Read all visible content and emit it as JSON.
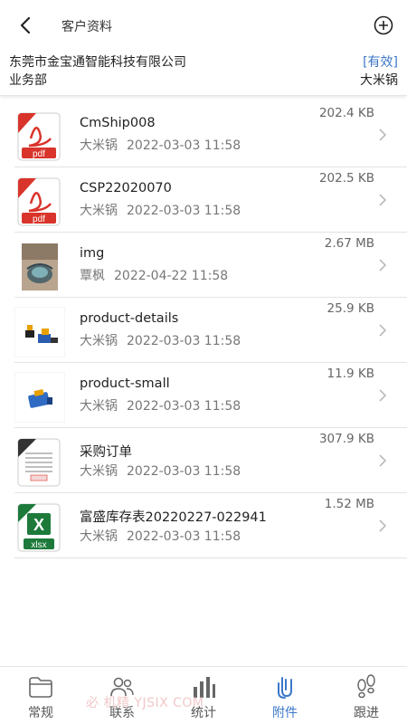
{
  "header": {
    "title": "客户资料",
    "back_icon": "back-arrow-icon",
    "add_icon": "plus-circle-icon"
  },
  "company": {
    "name": "东莞市金宝通智能科技有限公司",
    "status": "[有效]",
    "department": "业务部",
    "owner": "大米锅",
    "status_color": "#3a78c9"
  },
  "files": [
    {
      "name": "CmShip008",
      "owner": "大米锅",
      "date": "2022-03-03 11:58",
      "size": "202.4 KB",
      "type": "pdf"
    },
    {
      "name": "CSP22020070",
      "owner": "大米锅",
      "date": "2022-03-03 11:58",
      "size": "202.5 KB",
      "type": "pdf"
    },
    {
      "name": "img",
      "owner": "覃枫",
      "date": "2022-04-22 11:58",
      "size": "2.67 MB",
      "type": "photo"
    },
    {
      "name": "product-details",
      "owner": "大米锅",
      "date": "2022-03-03 11:58",
      "size": "25.9 KB",
      "type": "product-photo"
    },
    {
      "name": "product-small",
      "owner": "大米锅",
      "date": "2022-03-03 11:58",
      "size": "11.9 KB",
      "type": "product-photo-small"
    },
    {
      "name": "采购订单",
      "owner": "大米锅",
      "date": "2022-03-03 11:58",
      "size": "307.9 KB",
      "type": "document"
    },
    {
      "name": "富盛库存表20220227-022941",
      "owner": "大米锅",
      "date": "2022-03-03 11:58",
      "size": "1.52 MB",
      "type": "xlsx"
    }
  ],
  "tabs": [
    {
      "label": "常规",
      "icon": "folder-icon",
      "active": false
    },
    {
      "label": "联系",
      "icon": "contacts-icon",
      "active": false
    },
    {
      "label": "统计",
      "icon": "bar-chart-icon",
      "active": false
    },
    {
      "label": "附件",
      "icon": "paperclip-icon",
      "active": true
    },
    {
      "label": "跟进",
      "icon": "footprints-icon",
      "active": false
    }
  ],
  "watermark": "必 机精 YJSIX COM",
  "colors": {
    "accent": "#3a78c9",
    "pdf_red": "#d9342b",
    "excel_green": "#1d7a3b"
  }
}
